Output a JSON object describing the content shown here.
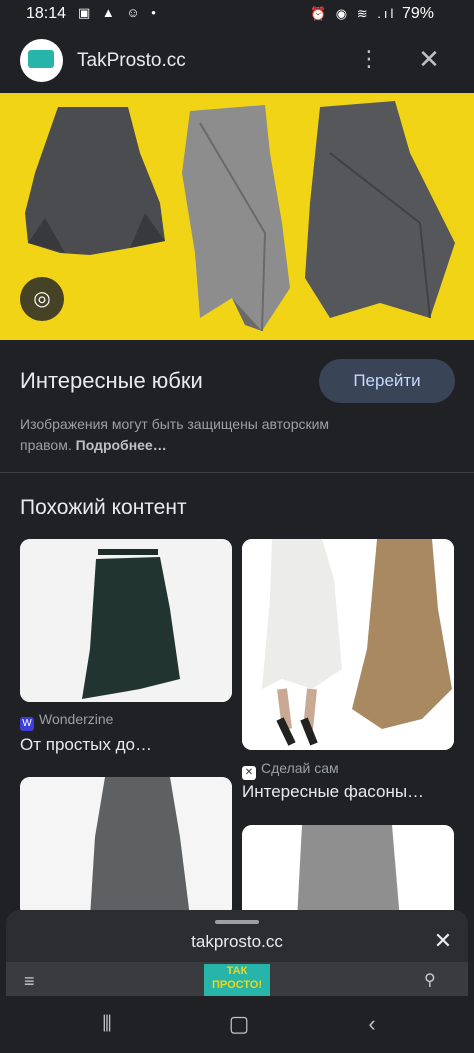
{
  "status_bar": {
    "time": "18:14",
    "battery": "79%"
  },
  "header": {
    "site_title": "TakProsto.cc"
  },
  "result": {
    "title": "Интересные юбки",
    "go_button": "Перейти",
    "copyright_text": "Изображения могут быть защищены авторским правом.",
    "more_link": "Подробнее…"
  },
  "similar": {
    "section_title": "Похожий контент",
    "cards": [
      {
        "source": "Wonderzine",
        "caption": "От простых до…",
        "source_icon_color": "#3b3fd8"
      },
      {
        "source": "Сделай сам",
        "caption": "Интересные фасоны…",
        "source_icon_color": "#ffffff"
      }
    ]
  },
  "sheet": {
    "url": "takprosto.cc",
    "preview_logo": "ТАК ПРОСТО!"
  },
  "colors": {
    "hero_bg": "#f2d417",
    "button_bg": "#394457",
    "logo_accent": "#26b5a8"
  }
}
